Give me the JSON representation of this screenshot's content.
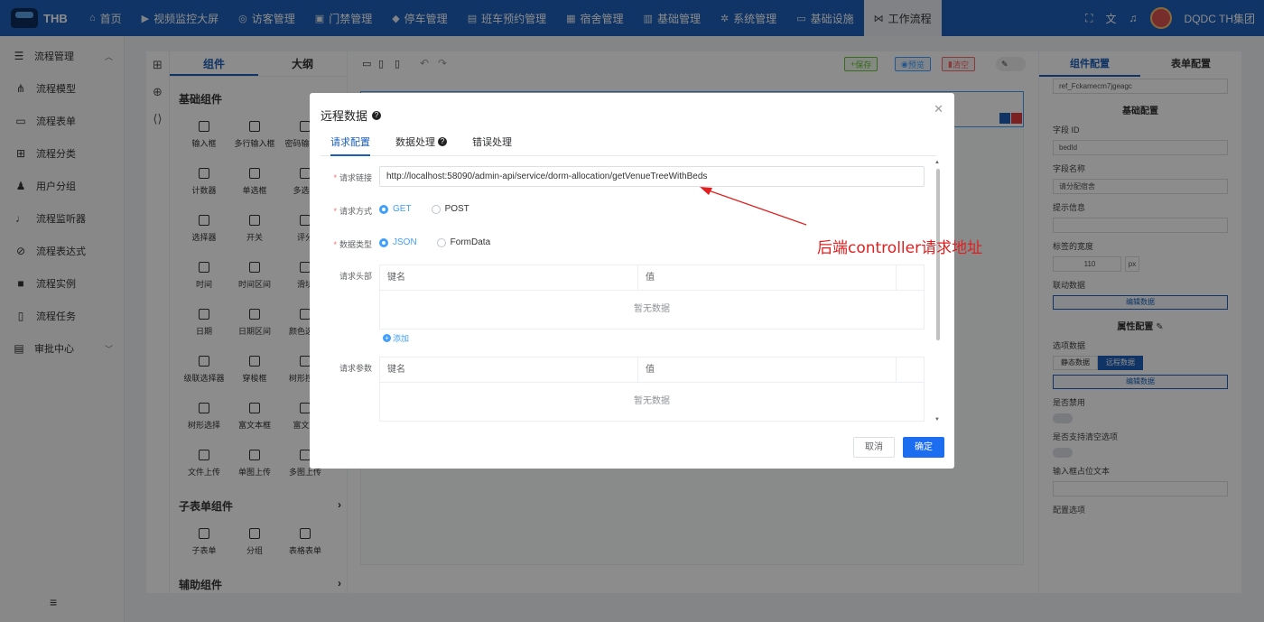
{
  "app": {
    "logo_text": "THB",
    "user": "DQDC TH集团"
  },
  "nav": [
    {
      "label": "首页",
      "icon": "home-icon"
    },
    {
      "label": "视频监控大屏",
      "icon": "video-icon"
    },
    {
      "label": "访客管理",
      "icon": "location-icon"
    },
    {
      "label": "门禁管理",
      "icon": "door-icon"
    },
    {
      "label": "停车管理",
      "icon": "car-icon"
    },
    {
      "label": "班车预约管理",
      "icon": "bus-icon"
    },
    {
      "label": "宿舍管理",
      "icon": "dorm-icon"
    },
    {
      "label": "基础管理",
      "icon": "calendar-icon"
    },
    {
      "label": "系统管理",
      "icon": "gear-icon"
    },
    {
      "label": "基础设施",
      "icon": "monitor-icon"
    },
    {
      "label": "工作流程",
      "icon": "workflow-icon"
    }
  ],
  "sidebar": {
    "group1": "流程管理",
    "items": [
      "流程模型",
      "流程表单",
      "流程分类",
      "用户分组",
      "流程监听器",
      "流程表达式",
      "流程实例",
      "流程任务"
    ],
    "group2": "审批中心"
  },
  "components": {
    "tab_components": "组件",
    "tab_outline": "大纲",
    "basic_title": "基础组件",
    "basic": [
      "输入框",
      "多行输入框",
      "密码输入框",
      "计数器",
      "单选框",
      "多选框",
      "选择器",
      "开关",
      "评分",
      "时间",
      "时间区间",
      "滑块",
      "日期",
      "日期区间",
      "颜色选择",
      "级联选择器",
      "穿梭框",
      "树形控件",
      "树形选择",
      "富文本框",
      "富文本",
      "文件上传",
      "单图上传",
      "多图上传"
    ],
    "sub_title": "子表单组件",
    "sub": [
      "子表单",
      "分组",
      "表格表单"
    ],
    "aux_title": "辅助组件"
  },
  "toolbar": {
    "save": "保存",
    "preview": "预览",
    "clear": "清空"
  },
  "right_panel": {
    "tab_component": "组件配置",
    "tab_form": "表单配置",
    "ref_value": "ref_Fckamecm7jgeagc",
    "basic_section": "基础配置",
    "field_id_label": "字段 ID",
    "field_id_value": "bedId",
    "field_name_label": "字段名称",
    "field_name_value": "请分配宿舍",
    "hint_label": "提示信息",
    "label_width_label": "标签的宽度",
    "label_width_value": "110",
    "label_width_unit": "px",
    "linked_label": "联动数据",
    "edit_data": "编辑数据",
    "attr_section": "属性配置",
    "options_label": "选项数据",
    "static_data": "静态数据",
    "remote_data": "远程数据",
    "disabled_label": "是否禁用",
    "clearable_label": "是否支持清空选项",
    "placeholder_label": "输入框占位文本",
    "config_options_label": "配置选项"
  },
  "modal": {
    "title": "远程数据",
    "tabs": [
      "请求配置",
      "数据处理",
      "错误处理"
    ],
    "url_label": "请求链接",
    "url_value": "http://localhost:58090/admin-api/service/dorm-allocation/getVenueTreeWithBeds",
    "method_label": "请求方式",
    "methods": [
      "GET",
      "POST"
    ],
    "type_label": "数据类型",
    "types": [
      "JSON",
      "FormData"
    ],
    "headers_label": "请求头部",
    "params_label": "请求参数",
    "col_key": "键名",
    "col_value": "值",
    "empty": "暂无数据",
    "add": "添加",
    "cancel": "取消",
    "confirm": "确定"
  },
  "annotation": {
    "text": "后端controller请求地址",
    "color": "#e02020"
  }
}
